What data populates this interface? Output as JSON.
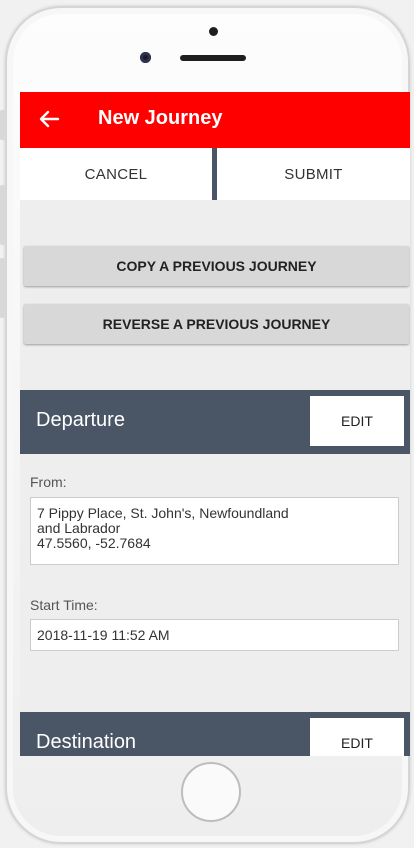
{
  "app_bar": {
    "title": "New Journey",
    "back_icon": "arrow-left-icon"
  },
  "actions": {
    "cancel_label": "CANCEL",
    "submit_label": "SUBMIT"
  },
  "buttons": {
    "copy_label": "COPY A PREVIOUS JOURNEY",
    "reverse_label": "REVERSE A PREVIOUS JOURNEY"
  },
  "departure": {
    "title": "Departure",
    "edit_label": "EDIT",
    "from_label": "From:",
    "from_line1": "7 Pippy Place, St. John's, Newfoundland",
    "from_line2": "and Labrador",
    "from_line3": "47.5560, -52.7684",
    "start_time_label": "Start Time:",
    "start_time_value": "2018-11-19 11:52 AM"
  },
  "destination": {
    "title": "Destination",
    "edit_label": "EDIT"
  },
  "colors": {
    "app_bar": "#ff0000",
    "section_header": "#4a5566",
    "background": "#eeeeee"
  }
}
